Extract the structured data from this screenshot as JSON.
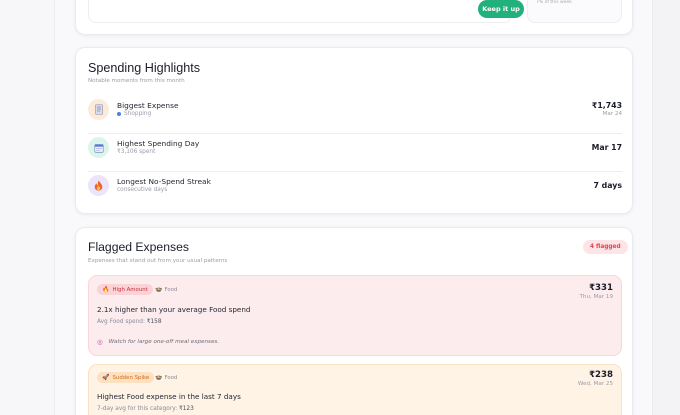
{
  "top_card": {
    "keep_button": "Keep it up",
    "faded_text": "7% of this week"
  },
  "highlights": {
    "title": "Spending Highlights",
    "subtitle": "Notable moments from this month",
    "items": [
      {
        "icon": "receipt-icon",
        "label": "Biggest Expense",
        "meta": "Shopping",
        "meta_dot_color": "#4c7df0",
        "value": "₹1,743",
        "date": "Mar 24"
      },
      {
        "icon": "calendar-icon",
        "label": "Highest Spending Day",
        "meta": "₹3,106 spent",
        "value": "Mar 17"
      },
      {
        "icon": "flame-icon",
        "label": "Longest No-Spend Streak",
        "meta": "consecutive days",
        "value": "7 days"
      }
    ]
  },
  "flagged": {
    "title": "Flagged Expenses",
    "subtitle": "Expenses that stand out from your usual patterns",
    "count_badge": "4 flagged",
    "items": [
      {
        "badge": "High Amount",
        "badge_icon": "fire-icon",
        "category": "Food",
        "category_icon": "bowl-icon",
        "amount": "₹331",
        "date": "Thu, Mar 19",
        "description": "2.1x higher than your average Food spend",
        "detail_label": "Avg Food spend:",
        "detail_value": "₹158",
        "tip": "Watch for large one-off meal expenses.",
        "tip_icon": "target-icon"
      },
      {
        "badge": "Sudden Spike",
        "badge_icon": "rocket-icon",
        "category": "Food",
        "category_icon": "bowl-icon",
        "amount": "₹238",
        "date": "Wed, Mar 25",
        "description": "Highest Food expense in the last 7 days",
        "detail_label": "7-day avg for this category:",
        "detail_value": "₹123"
      }
    ]
  },
  "colors": {
    "accent_green": "#22b07d",
    "flag_red": "#e0454f",
    "flag_red_bg": "#fdecee",
    "spike_orange_bg": "#fef3e5"
  }
}
